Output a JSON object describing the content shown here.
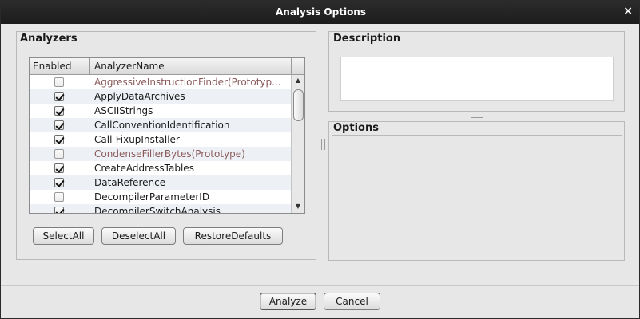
{
  "window": {
    "title": "Analysis Options",
    "close_label": "×"
  },
  "analyzers": {
    "label": "Analyzers",
    "columns": {
      "enabled": "Enabled",
      "name": "AnalyzerName"
    },
    "rows": [
      {
        "enabled": false,
        "name": "AggressiveInstructionFinder(Prototyp...",
        "prototype": true
      },
      {
        "enabled": true,
        "name": "ApplyDataArchives",
        "prototype": false
      },
      {
        "enabled": true,
        "name": "ASCIIStrings",
        "prototype": false
      },
      {
        "enabled": true,
        "name": "CallConventionIdentification",
        "prototype": false
      },
      {
        "enabled": true,
        "name": "Call-FixupInstaller",
        "prototype": false
      },
      {
        "enabled": false,
        "name": "CondenseFillerBytes(Prototype)",
        "prototype": true
      },
      {
        "enabled": true,
        "name": "CreateAddressTables",
        "prototype": false
      },
      {
        "enabled": true,
        "name": "DataReference",
        "prototype": false
      },
      {
        "enabled": false,
        "name": "DecompilerParameterID",
        "prototype": false
      },
      {
        "enabled": true,
        "name": "DecompilerSwitchAnalysis",
        "prototype": false
      }
    ],
    "buttons": {
      "select_all": "SelectAll",
      "deselect_all": "DeselectAll",
      "restore_defaults": "RestoreDefaults"
    }
  },
  "description": {
    "label": "Description",
    "text": ""
  },
  "options": {
    "label": "Options"
  },
  "footer": {
    "analyze": "Analyze",
    "cancel": "Cancel"
  },
  "colors": {
    "prototype_text": "#8a5a5a",
    "titlebar": "#1c1c1c",
    "background": "#e7e7e7"
  }
}
